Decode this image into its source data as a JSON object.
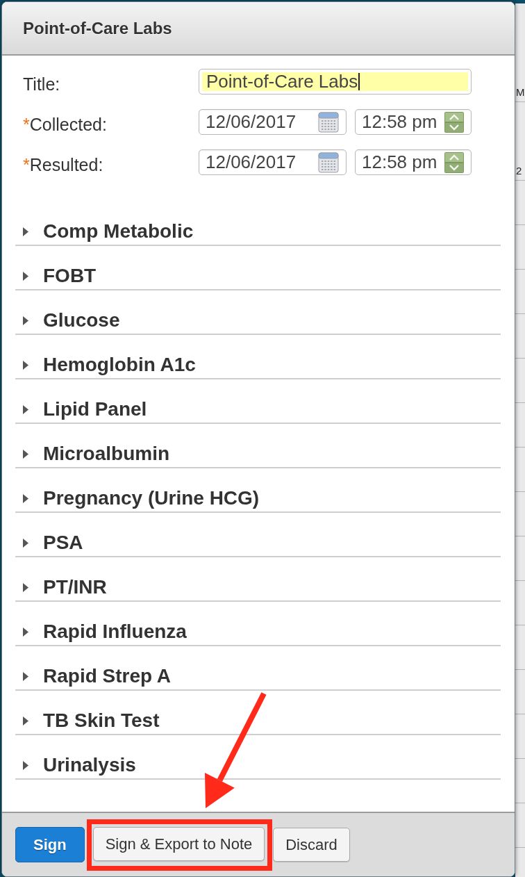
{
  "dialog": {
    "title": "Point-of-Care Labs"
  },
  "form": {
    "title_field": {
      "label": "Title:",
      "value": "Point-of-Care Labs",
      "focused": true
    },
    "datetime_fields": [
      {
        "required_mark": "*",
        "label": "Collected:",
        "date": "12/06/2017",
        "time": "12:58 pm"
      },
      {
        "required_mark": "*",
        "label": "Resulted:",
        "date": "12/06/2017",
        "time": "12:58 pm"
      }
    ]
  },
  "sections": [
    {
      "label": "Comp Metabolic",
      "expanded": false
    },
    {
      "label": "FOBT",
      "expanded": false
    },
    {
      "label": "Glucose",
      "expanded": false
    },
    {
      "label": "Hemoglobin A1c",
      "expanded": false
    },
    {
      "label": "Lipid Panel",
      "expanded": false
    },
    {
      "label": "Microalbumin",
      "expanded": false
    },
    {
      "label": "Pregnancy (Urine HCG)",
      "expanded": false
    },
    {
      "label": "PSA",
      "expanded": false
    },
    {
      "label": "PT/INR",
      "expanded": false
    },
    {
      "label": "Rapid Influenza",
      "expanded": false
    },
    {
      "label": "Rapid Strep A",
      "expanded": false
    },
    {
      "label": "TB Skin Test",
      "expanded": false
    },
    {
      "label": "Urinalysis",
      "expanded": false
    }
  ],
  "footer": {
    "buttons": [
      {
        "label": "Sign",
        "kind": "primary",
        "callout": false
      },
      {
        "label": "Sign & Export to Note",
        "kind": "default",
        "callout": true
      },
      {
        "label": "Discard",
        "kind": "default",
        "callout": false
      }
    ]
  },
  "background_window": {
    "texts": [
      "M",
      "2"
    ]
  }
}
